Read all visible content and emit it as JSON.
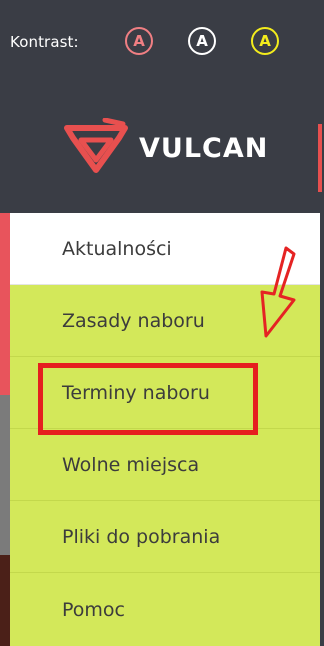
{
  "contrast": {
    "label": "Kontrast:",
    "buttons": [
      {
        "label": "A",
        "color": "#f07f83"
      },
      {
        "label": "A",
        "color": "#ffffff"
      },
      {
        "label": "A",
        "color": "#f3ec1c"
      }
    ]
  },
  "logo": {
    "text": "VULCAN",
    "icon": "vulcan-logo-icon",
    "color": "#e8504f"
  },
  "menu": {
    "items": [
      {
        "label": "Aktualności",
        "active": true
      },
      {
        "label": "Zasady naboru"
      },
      {
        "label": "Terminy naboru",
        "highlighted": true
      },
      {
        "label": "Wolne miejsca"
      },
      {
        "label": "Pliki do pobrania"
      },
      {
        "label": "Pomoc"
      }
    ]
  },
  "annotations": {
    "arrow_icon": "down-left-arrow-icon",
    "arrow_color": "#e52323",
    "highlight_color": "#e51f1f"
  },
  "colors": {
    "header_bg": "#3a3d45",
    "menu_bg": "#d3e85a",
    "active_bg": "#ffffff"
  }
}
